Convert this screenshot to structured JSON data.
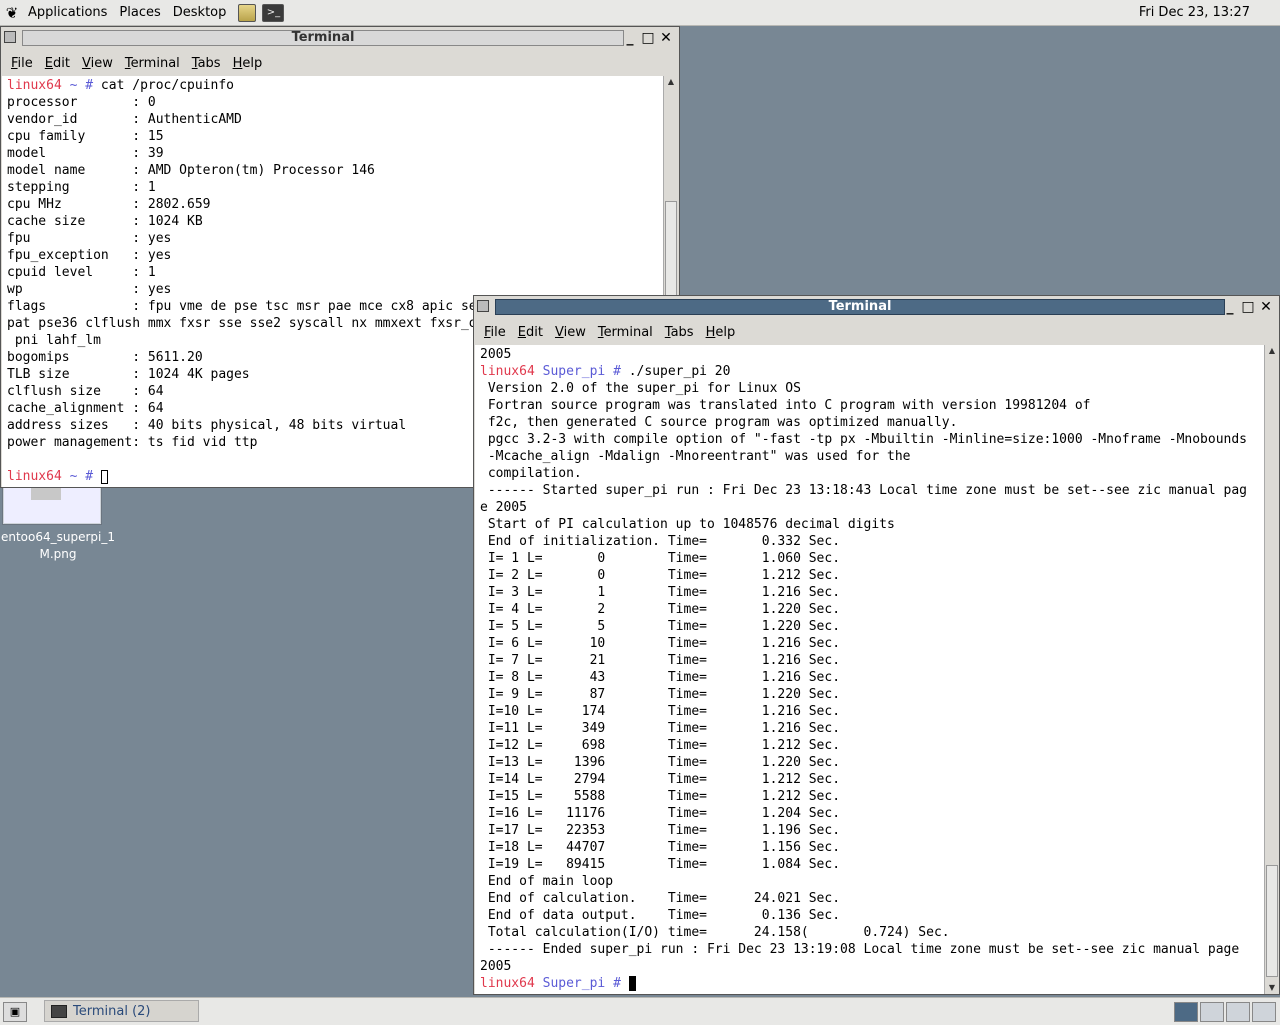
{
  "top_panel": {
    "menus": [
      "Applications",
      "Places",
      "Desktop"
    ],
    "clock": "Fri Dec 23, 13:27"
  },
  "desktop_icon": {
    "label_line1": "entoo64_superpi_1",
    "label_line2": "M.png"
  },
  "window1": {
    "title": "Terminal",
    "menu": [
      "File",
      "Edit",
      "View",
      "Terminal",
      "Tabs",
      "Help"
    ],
    "prompt_host": "linux64",
    "prompt_dir": " ~ #",
    "command": " cat /proc/cpuinfo",
    "lines": [
      "processor       : 0",
      "vendor_id       : AuthenticAMD",
      "cpu family      : 15",
      "model           : 39",
      "model name      : AMD Opteron(tm) Processor 146",
      "stepping        : 1",
      "cpu MHz         : 2802.659",
      "cache size      : 1024 KB",
      "fpu             : yes",
      "fpu_exception   : yes",
      "cpuid level     : 1",
      "wp              : yes",
      "flags           : fpu vme de pse tsc msr pae mce cx8 apic sep mtrr pge mca cmov",
      "pat pse36 clflush mmx fxsr sse sse2 syscall nx mmxext fxsr_opt lm 3dnowext 3dnow",
      " pni lahf_lm",
      "bogomips        : 5611.20",
      "TLB size        : 1024 4K pages",
      "clflush size    : 64",
      "cache_alignment : 64",
      "address sizes   : 40 bits physical, 48 bits virtual",
      "power management: ts fid vid ttp",
      ""
    ],
    "final_prompt_host": "linux64",
    "final_prompt_dir": " ~ #"
  },
  "window2": {
    "title": "Terminal",
    "menu": [
      "File",
      "Edit",
      "View",
      "Terminal",
      "Tabs",
      "Help"
    ],
    "first_line": "2005",
    "prompt_host": "linux64",
    "prompt_dir": " Super_pi #",
    "command": " ./super_pi 20",
    "lines": [
      " Version 2.0 of the super_pi for Linux OS",
      " Fortran source program was translated into C program with version 19981204 of",
      " f2c, then generated C source program was optimized manually.",
      " pgcc 3.2-3 with compile option of \"-fast -tp px -Mbuiltin -Minline=size:1000 -Mnoframe -Mnobounds",
      " -Mcache_align -Mdalign -Mnoreentrant\" was used for the",
      " compilation.",
      " ------ Started super_pi run : Fri Dec 23 13:18:43 Local time zone must be set--see zic manual pag",
      "e 2005",
      " Start of PI calculation up to 1048576 decimal digits",
      " End of initialization. Time=       0.332 Sec.",
      " I= 1 L=       0        Time=       1.060 Sec.",
      " I= 2 L=       0        Time=       1.212 Sec.",
      " I= 3 L=       1        Time=       1.216 Sec.",
      " I= 4 L=       2        Time=       1.220 Sec.",
      " I= 5 L=       5        Time=       1.220 Sec.",
      " I= 6 L=      10        Time=       1.216 Sec.",
      " I= 7 L=      21        Time=       1.216 Sec.",
      " I= 8 L=      43        Time=       1.216 Sec.",
      " I= 9 L=      87        Time=       1.220 Sec.",
      " I=10 L=     174        Time=       1.216 Sec.",
      " I=11 L=     349        Time=       1.216 Sec.",
      " I=12 L=     698        Time=       1.212 Sec.",
      " I=13 L=    1396        Time=       1.220 Sec.",
      " I=14 L=    2794        Time=       1.212 Sec.",
      " I=15 L=    5588        Time=       1.212 Sec.",
      " I=16 L=   11176        Time=       1.204 Sec.",
      " I=17 L=   22353        Time=       1.196 Sec.",
      " I=18 L=   44707        Time=       1.156 Sec.",
      " I=19 L=   89415        Time=       1.084 Sec.",
      " End of main loop",
      " End of calculation.    Time=      24.021 Sec.",
      " End of data output.    Time=       0.136 Sec.",
      " Total calculation(I/O) time=      24.158(       0.724) Sec.",
      " ------ Ended super_pi run : Fri Dec 23 13:19:08 Local time zone must be set--see zic manual page",
      "2005"
    ],
    "final_prompt_host": "linux64",
    "final_prompt_dir": " Super_pi #"
  },
  "bottom_panel": {
    "task_label": "Terminal (2)"
  },
  "colors": {
    "desktop": "#788794",
    "prompt_host": "#e0384c",
    "prompt_dir": "#5b5bd6",
    "active_title": "#4d6a85"
  }
}
